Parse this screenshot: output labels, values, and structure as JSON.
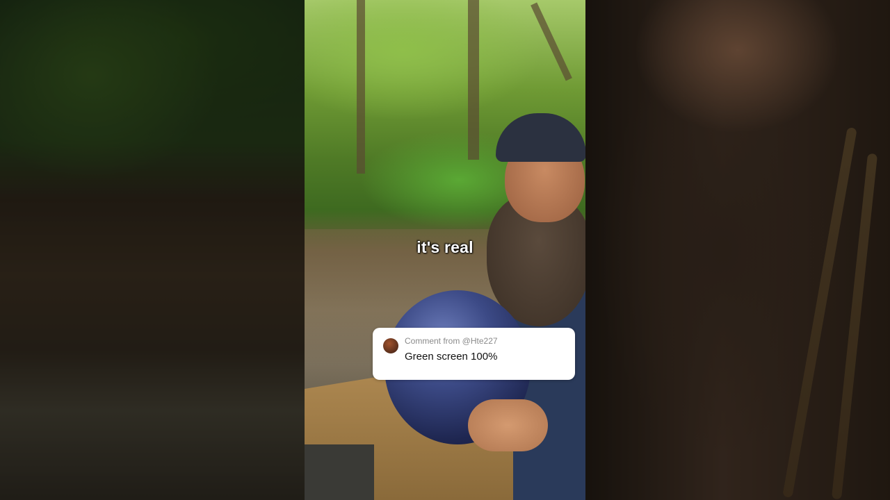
{
  "video": {
    "caption": "it's real"
  },
  "comment": {
    "from_label": "Comment from @Hte227",
    "text": "Green screen 100%"
  }
}
